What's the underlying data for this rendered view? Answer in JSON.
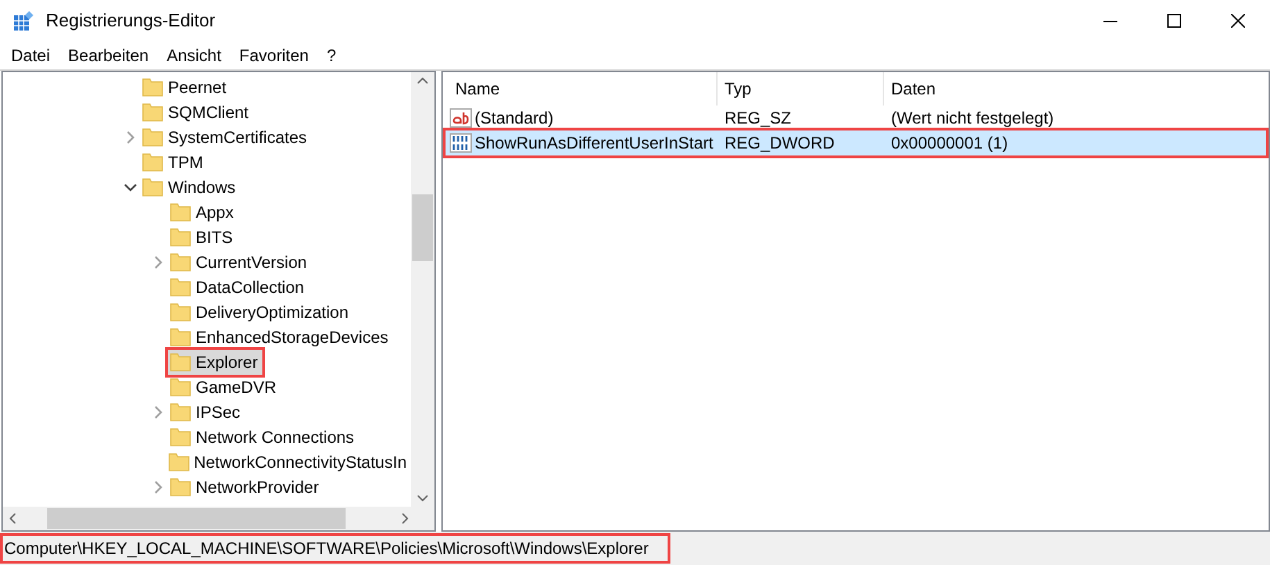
{
  "window": {
    "title": "Registrierungs-Editor"
  },
  "menu": [
    "Datei",
    "Bearbeiten",
    "Ansicht",
    "Favoriten",
    "?"
  ],
  "tree": [
    {
      "label": "Peernet",
      "selected": false
    },
    {
      "label": "SQMClient",
      "selected": false
    },
    {
      "label": "SystemCertificates",
      "expanded": false,
      "selected": false
    },
    {
      "label": "TPM",
      "selected": false
    },
    {
      "label": "Windows",
      "expanded": true,
      "selected": false,
      "children": [
        {
          "label": "Appx",
          "selected": false
        },
        {
          "label": "BITS",
          "selected": false
        },
        {
          "label": "CurrentVersion",
          "expanded": false,
          "selected": false
        },
        {
          "label": "DataCollection",
          "selected": false
        },
        {
          "label": "DeliveryOptimization",
          "selected": false
        },
        {
          "label": "EnhancedStorageDevices",
          "selected": false
        },
        {
          "label": "Explorer",
          "selected": true
        },
        {
          "label": "GameDVR",
          "selected": false
        },
        {
          "label": "IPSec",
          "expanded": false,
          "selected": false
        },
        {
          "label": "Network Connections",
          "selected": false
        },
        {
          "label": "NetworkConnectivityStatusIn",
          "selected": false
        },
        {
          "label": "NetworkProvider",
          "expanded": false,
          "selected": false
        }
      ]
    }
  ],
  "table": {
    "columns": [
      "Name",
      "Typ",
      "Daten"
    ],
    "rows": [
      {
        "kind": "string",
        "name": "(Standard)",
        "type": "REG_SZ",
        "data": "(Wert nicht festgelegt)",
        "selected": false
      },
      {
        "kind": "binary",
        "name": "ShowRunAsDifferentUserInStart",
        "type": "REG_DWORD",
        "data": "0x00000001 (1)",
        "selected": true
      }
    ]
  },
  "status_bar": "Computer\\HKEY_LOCAL_MACHINE\\SOFTWARE\\Policies\\Microsoft\\Windows\\Explorer"
}
